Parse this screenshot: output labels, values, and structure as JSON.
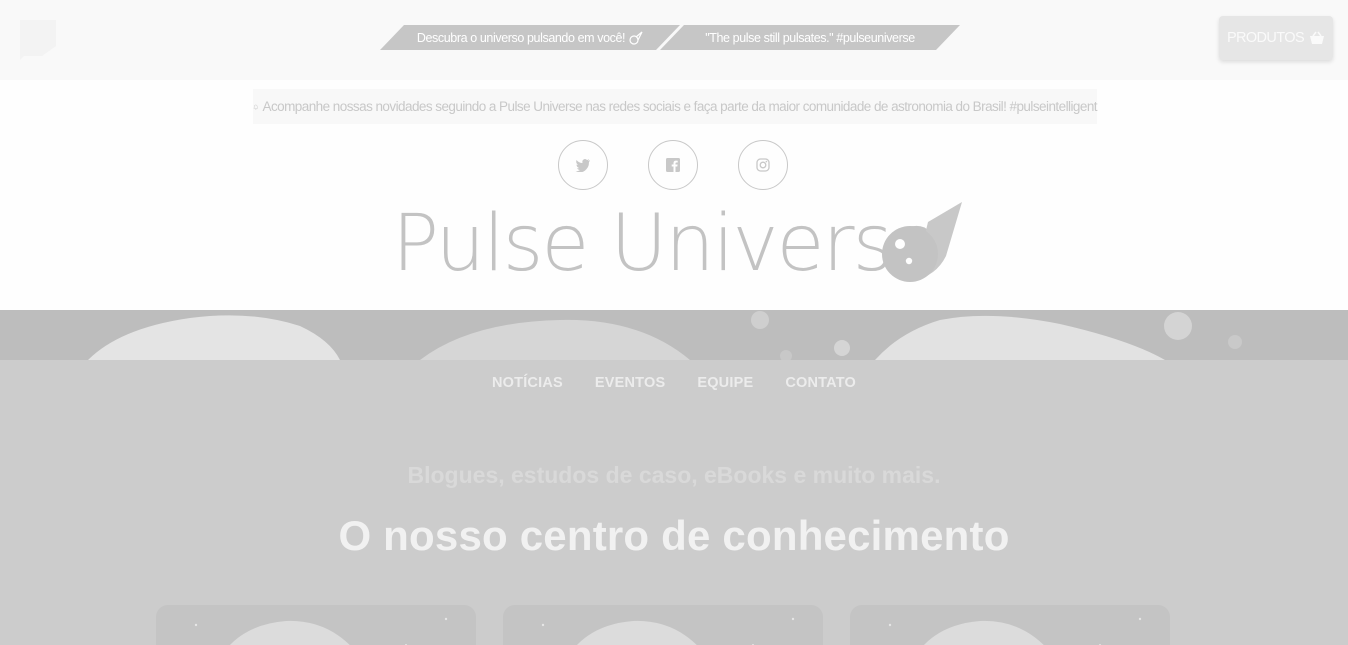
{
  "header": {
    "ribbons": [
      {
        "text": "Descubra o universo pulsando em você!"
      },
      {
        "text": "\"The pulse still pulsates.\" #pulseuniverse"
      }
    ],
    "products_button": {
      "label": "PRODUTOS",
      "icon": "basket-icon"
    },
    "notice": {
      "icon": "bell-icon",
      "text": "Acompanhe nossas novidades seguindo a Pulse Universe nas redes sociais e faça parte da maior comunidade de astronomia do Brasil! #pulseintelligent"
    },
    "social": [
      {
        "name": "twitter",
        "icon": "twitter-icon"
      },
      {
        "name": "facebook",
        "icon": "facebook-icon"
      },
      {
        "name": "instagram",
        "icon": "instagram-icon"
      }
    ],
    "brand": {
      "name": "Pulse Universe",
      "icon": "comet-icon"
    }
  },
  "nav": {
    "items": [
      {
        "label": "NOTÍCIAS"
      },
      {
        "label": "EVENTOS"
      },
      {
        "label": "EQUIPE"
      },
      {
        "label": "CONTATO"
      }
    ]
  },
  "hero": {
    "subtitle": "Blogues, estudos de caso, eBooks e muito mais.",
    "title": "O nosso centro de conhecimento"
  },
  "cards": {
    "count_visible": 3,
    "image": "asteroid-image"
  },
  "colors": {
    "background": "#cccccc",
    "header_background": "#fefefe",
    "ribbon": "#c6c6c6",
    "text_light": "#f1f1f1"
  }
}
